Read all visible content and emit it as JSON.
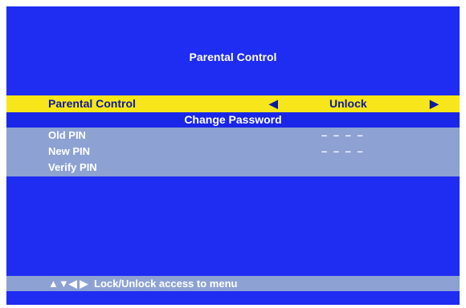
{
  "title": "Parental Control",
  "parental_row": {
    "label": "Parental Control",
    "left_arrow": "◀",
    "value": "Unlock",
    "right_arrow": "▶"
  },
  "section_title": "Change Password",
  "pins": [
    {
      "label": "Old PIN",
      "value": "– – – –"
    },
    {
      "label": "New PIN",
      "value": "– – – –"
    },
    {
      "label": "Verify PIN",
      "value": ""
    }
  ],
  "help": {
    "icons": "▲▼◀ ▶",
    "text": "Lock/Unlock access to menu"
  },
  "colors": {
    "background": "#1f2cf2",
    "highlight": "#f7e619",
    "panel": "#8da1d3"
  }
}
